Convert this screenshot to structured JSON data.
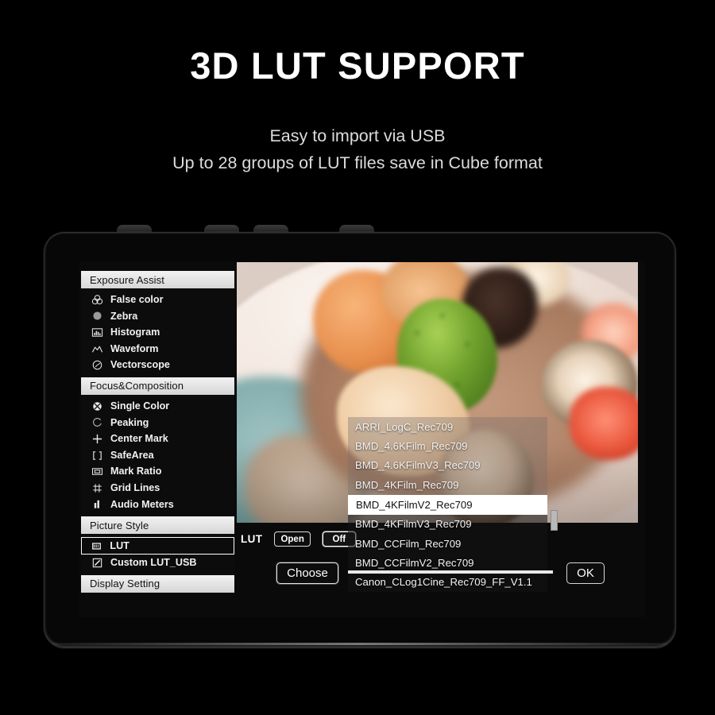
{
  "header": {
    "headline": "3D LUT SUPPORT",
    "sub1": "Easy to import via USB",
    "sub2": "Up to 28 groups of LUT files save in Cube format"
  },
  "osd": {
    "sections": [
      {
        "title": "Exposure Assist",
        "items": [
          {
            "label": "False color",
            "icon": "false-color-icon",
            "selected": false
          },
          {
            "label": "Zebra",
            "icon": "zebra-icon",
            "selected": false
          },
          {
            "label": "Histogram",
            "icon": "histogram-icon",
            "selected": false
          },
          {
            "label": "Waveform",
            "icon": "waveform-icon",
            "selected": false
          },
          {
            "label": "Vectorscope",
            "icon": "vectorscope-icon",
            "selected": false
          }
        ]
      },
      {
        "title": "Focus&Composition",
        "items": [
          {
            "label": "Single Color",
            "icon": "single-color-icon",
            "selected": false
          },
          {
            "label": "Peaking",
            "icon": "peaking-icon",
            "selected": false
          },
          {
            "label": "Center Mark",
            "icon": "center-mark-icon",
            "selected": false
          },
          {
            "label": "SafeArea",
            "icon": "safe-area-icon",
            "selected": false
          },
          {
            "label": "Mark Ratio",
            "icon": "mark-ratio-icon",
            "selected": false
          },
          {
            "label": "Grid Lines",
            "icon": "grid-lines-icon",
            "selected": false
          },
          {
            "label": "Audio Meters",
            "icon": "audio-meters-icon",
            "selected": false
          }
        ]
      },
      {
        "title": "Picture Style",
        "items": [
          {
            "label": "LUT",
            "icon": "lut-icon",
            "selected": true
          },
          {
            "label": "Custom LUT_USB",
            "icon": "custom-lut-usb-icon",
            "selected": false
          }
        ]
      },
      {
        "title": "Display Setting",
        "items": []
      }
    ]
  },
  "lut_panel": {
    "label": "LUT",
    "toggle_open": "Open",
    "toggle_off": "Off",
    "active_toggle": "Off",
    "choose_button": "Choose",
    "ok_button": "OK",
    "files": [
      {
        "name": "ARRI_LogC_Rec709",
        "selected": false
      },
      {
        "name": "BMD_4.6KFilm_Rec709",
        "selected": false
      },
      {
        "name": "BMD_4.6KFilmV3_Rec709",
        "selected": false
      },
      {
        "name": "BMD_4KFilm_Rec709",
        "selected": false
      },
      {
        "name": "BMD_4KFilmV2_Rec709",
        "selected": true
      },
      {
        "name": "BMD_4KFilmV3_Rec709",
        "selected": false
      },
      {
        "name": "BMD_CCFilm_Rec709",
        "selected": false
      },
      {
        "name": "BMD_CCFilmV2_Rec709",
        "selected": false
      },
      {
        "name": "Canon_CLog1Cine_Rec709_FF_V1.1",
        "selected": false
      }
    ]
  },
  "colors": {
    "background": "#000000",
    "headline": "#ffffff",
    "subtext": "#dcdcdc",
    "section_header_bg": "#e6e6e6",
    "selection_white": "#ffffff",
    "osd_text": "#f2f2f2"
  }
}
